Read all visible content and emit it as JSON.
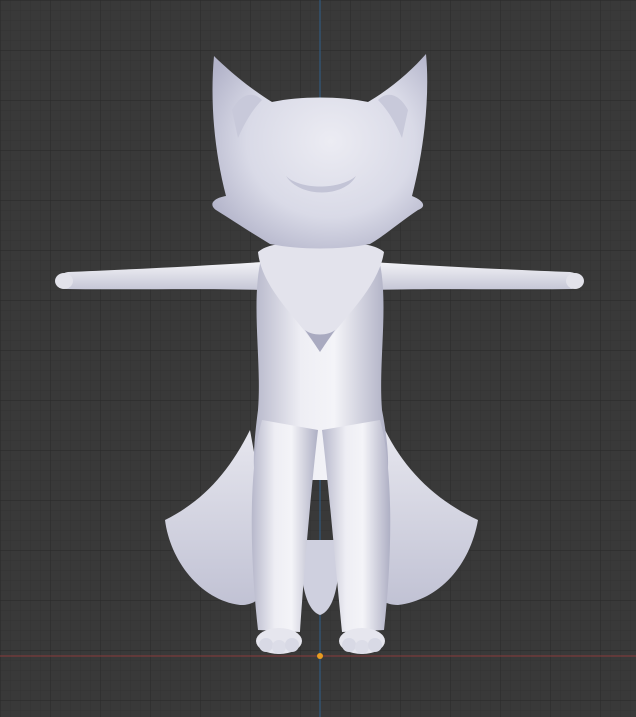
{
  "viewport": {
    "background": "#393939",
    "grid_minor_color": "#333333",
    "grid_major_color": "#2b2b2b",
    "axis_x_color": "#8a3a3a",
    "axis_z_color": "#2f5f8a",
    "origin_color": "#e89b20"
  },
  "model": {
    "body_light": "#f2f2f7",
    "body_mid": "#d4d5e3",
    "body_shadow": "#9fa0b6"
  }
}
